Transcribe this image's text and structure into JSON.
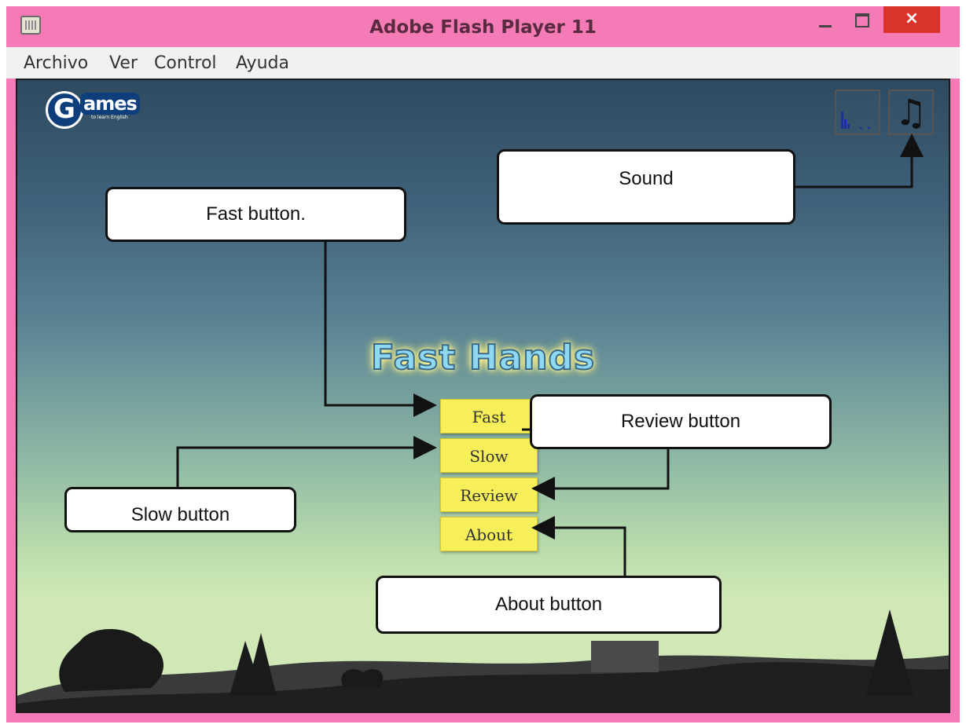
{
  "window": {
    "title": "Adobe Flash Player 11",
    "close_glyph": "×"
  },
  "menubar": [
    "Archivo",
    "Ver",
    "Control",
    "Ayuda"
  ],
  "game": {
    "logo_letter": "G",
    "logo_text": "ames",
    "logo_tagline": "to learn English",
    "title": "Fast Hands",
    "music_glyph": "♫",
    "buttons": [
      "Fast",
      "Slow",
      "Review",
      "About"
    ]
  },
  "callouts": {
    "sound": "Sound",
    "fast": "Fast button.",
    "review": "Review button",
    "slow": "Slow button",
    "about": "About button"
  },
  "colors": {
    "frame": "#f57bb6",
    "close": "#d9332b",
    "button": "#f6ef5a",
    "title_fill": "#8fd8f2",
    "title_glow": "#fff27a"
  },
  "icons": [
    "app-icon",
    "minimize-icon",
    "maximize-icon",
    "close-icon",
    "quality-icon",
    "music-note-icon"
  ]
}
